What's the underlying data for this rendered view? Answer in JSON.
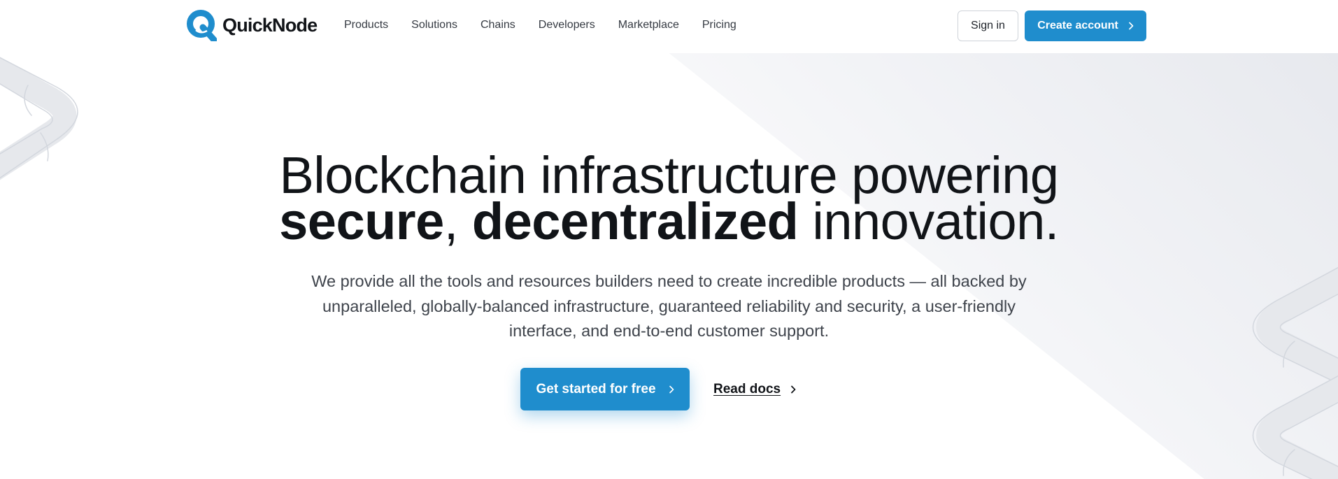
{
  "brand": {
    "name": "QuickNode",
    "accent_color": "#1f8dcd"
  },
  "nav": {
    "items": [
      {
        "label": "Products"
      },
      {
        "label": "Solutions"
      },
      {
        "label": "Chains"
      },
      {
        "label": "Developers"
      },
      {
        "label": "Marketplace"
      },
      {
        "label": "Pricing"
      }
    ],
    "sign_in_label": "Sign in",
    "create_account_label": "Create account"
  },
  "hero": {
    "headline_line1": "Blockchain infrastructure powering",
    "headline_bold_1": "secure",
    "headline_sep": ", ",
    "headline_bold_2": "decentralized",
    "headline_tail": " innovation.",
    "subheading": "We provide all the tools and resources builders need to create incredible products — all backed by unparalleled, globally-balanced infrastructure, guaranteed reliability and security, a user-friendly interface, and end-to-end customer support.",
    "primary_cta_label": "Get started for free",
    "secondary_cta_label": "Read docs"
  },
  "icons": {
    "logo": "quicknode-logo-icon",
    "chevron": "chevron-right-icon"
  }
}
